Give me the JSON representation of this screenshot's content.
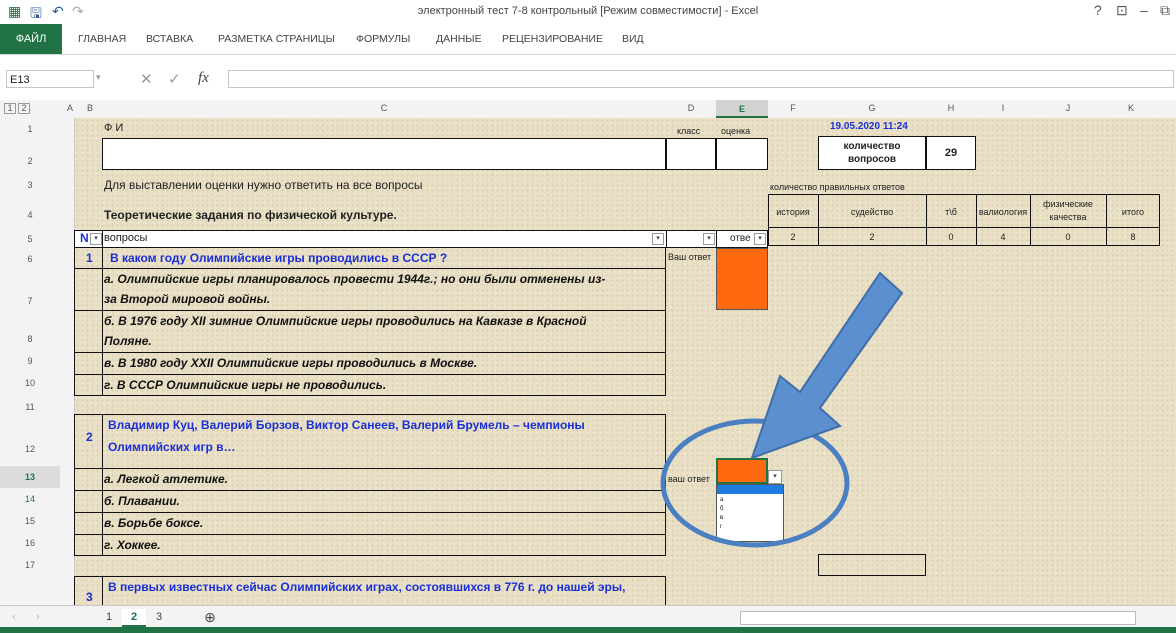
{
  "window": {
    "title": "электронный тест 7-8 контрольный  [Режим совместимости] - Excel",
    "help": "?",
    "min": "–"
  },
  "ribbon_tabs": [
    "ФАЙЛ",
    "ГЛАВНАЯ",
    "ВСТАВКА",
    "РАЗМЕТКА СТРАНИЦЫ",
    "ФОРМУЛЫ",
    "ДАННЫЕ",
    "РЕЦЕНЗИРОВАНИЕ",
    "ВИД"
  ],
  "formula_bar": {
    "name_box": "E13",
    "fx": "fx",
    "value": ""
  },
  "columns": [
    "A",
    "B",
    "C",
    "D",
    "E",
    "F",
    "G",
    "H",
    "I",
    "J",
    "K"
  ],
  "outline_levels": [
    "1",
    "2"
  ],
  "rows": [
    "1",
    "2",
    "3",
    "4",
    "5",
    "6",
    "7",
    "8",
    "9",
    "10",
    "11",
    "12",
    "13",
    "14",
    "15",
    "16",
    "17"
  ],
  "sheet": {
    "fi": "Ф И",
    "klass": "класс",
    "ocenka": "оценка",
    "datetime": "19.05.2020 11:24",
    "kolichestvo_label": "количество вопросов",
    "kolichestvo_value": "29",
    "instruction": "Для выставлении оценки нужно ответить на все вопросы",
    "heading": "Теоретические задания по физической культуре.",
    "col_n": "N",
    "col_voprosy": "вопросы",
    "col_otvet": "отве",
    "vash_otvet": "Ваш ответ",
    "vash_otvet2": "ваш ответ",
    "q1": {
      "num": "1",
      "question": "В каком году Олимпийские игры проводились в СССР ?",
      "a1": "а. Олимпийские игры планировалось провести 1944г.; но они были отменены из-",
      "a1b": "за    Второй мировой войны.",
      "a2": "б. В 1976 году XII зимние Олимпийские игры проводились на Кавказе в Красной",
      "a2b": "Поляне.",
      "a3": "в. В 1980 году XXII Олимпийские игры проводились в Москве.",
      "a4": "г. В СССР Олимпийские игры  не проводились."
    },
    "q2": {
      "num": "2",
      "question": "Владимир Куц, Валерий Борзов, Виктор Санеев, Валерий Брумель – чемпионы",
      "question_b": "Олимпийских игр в…",
      "a1": "а. Легкой атлетике.",
      "a2": "б. Плавании.",
      "a3": "в. Борьбе  боксе.",
      "a4": "г. Хоккее."
    },
    "q3": {
      "num": "3",
      "question": "В первых известных сейчас Олимпийских играх, состоявшихся в 776 г. до нашей эры,"
    },
    "dropdown_options": [
      "а",
      "б",
      "в",
      "г"
    ]
  },
  "stats": {
    "title": "количество правильных ответов",
    "headers": [
      "история",
      "судейство",
      "т\\б",
      "валиология",
      "физические качества",
      "итого"
    ],
    "values": [
      "2",
      "2",
      "0",
      "4",
      "0",
      "8"
    ]
  },
  "sheet_tabs": [
    "1",
    "2",
    "3"
  ],
  "active_sheet": "2",
  "colors": {
    "excel_green": "#217346",
    "answer_cell": "#ff6a10",
    "arrow": "#4a7fc1",
    "question_text": "#1a2fd6"
  }
}
